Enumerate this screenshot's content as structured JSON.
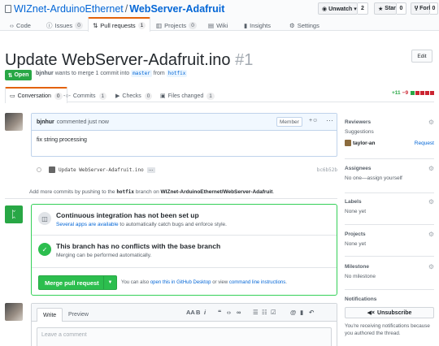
{
  "repo": {
    "owner": "WIZnet-ArduinoEthernet",
    "separator": "/",
    "name": "WebServer-Adafruit"
  },
  "header_buttons": {
    "unwatch_label": "Unwatch ▾",
    "unwatch_count": "2",
    "star_label": "Star",
    "star_count": "0",
    "fork_label": "Fork",
    "fork_count": "0"
  },
  "repo_tabs": [
    {
      "label": "Code",
      "count": ""
    },
    {
      "label": "Issues",
      "count": "0"
    },
    {
      "label": "Pull requests",
      "count": "1"
    },
    {
      "label": "Projects",
      "count": "0"
    },
    {
      "label": "Wiki",
      "count": ""
    },
    {
      "label": "Insights",
      "count": ""
    },
    {
      "label": "Settings",
      "count": ""
    }
  ],
  "pr": {
    "title": "Update WebServer-Adafruit.ino",
    "number": "#1",
    "edit_label": "Edit",
    "state": "Open",
    "author": "bjnhur",
    "meta_text": "wants to merge 1 commit into",
    "base_branch": "master",
    "from_text": "from",
    "head_branch": "hotfix"
  },
  "pr_tabs": [
    {
      "label": "Conversation",
      "count": "0"
    },
    {
      "label": "Commits",
      "count": "1"
    },
    {
      "label": "Checks",
      "count": "0"
    },
    {
      "label": "Files changed",
      "count": "1"
    }
  ],
  "diffstat": {
    "additions": "+11",
    "deletions": "−9"
  },
  "comment": {
    "author": "bjnhur",
    "time_text": "commented just now",
    "role": "Member",
    "body": "fix string processing"
  },
  "commit": {
    "message": "Update WebServer-Adafruit.ino",
    "ellipsis": "…",
    "sha": "bc6b52b"
  },
  "push_note": {
    "prefix": "Add more commits by pushing to the",
    "branch": "hotfix",
    "middle": "branch on",
    "repo": "WIZnet-ArduinoEthernet/WebServer-Adafruit",
    "end": "."
  },
  "merge": {
    "ci_title": "Continuous integration has not been set up",
    "ci_link": "Several apps are available",
    "ci_rest": "to automatically catch bugs and enforce style.",
    "conflict_title": "This branch has no conflicts with the base branch",
    "conflict_sub": "Merging can be performed automatically.",
    "merge_button": "Merge pull request",
    "also_prefix": "You can also",
    "desktop_link": "open this in GitHub Desktop",
    "or_view": "or view",
    "cli_link": "command line instructions",
    "period": "."
  },
  "editor": {
    "write_tab": "Write",
    "preview_tab": "Preview",
    "placeholder": "Leave a comment"
  },
  "sidebar": {
    "reviewers_label": "Reviewers",
    "suggestions_label": "Suggestions",
    "suggested_reviewer": "taylor-an",
    "request_label": "Request",
    "assignees_label": "Assignees",
    "assignees_value": "No one—assign yourself",
    "labels_label": "Labels",
    "labels_value": "None yet",
    "projects_label": "Projects",
    "projects_value": "None yet",
    "milestone_label": "Milestone",
    "milestone_value": "No milestone",
    "notifications_label": "Notifications",
    "unsubscribe_label": "Unsubscribe",
    "notification_reason": "You're receiving notifications because you authored the thread."
  },
  "colors": {
    "accent": "#0366d6",
    "open_green": "#28a745",
    "tab_orange": "#e36209",
    "deletion_red": "#cb2431"
  }
}
